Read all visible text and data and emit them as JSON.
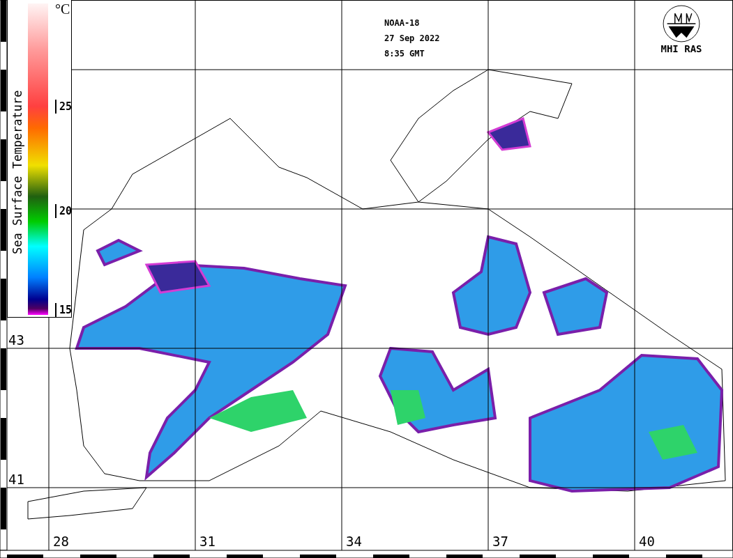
{
  "header": {
    "satellite": "NOAA-18",
    "date": "27 Sep 2022",
    "time": "8:35 GMT"
  },
  "logo": {
    "text": "MHI RAS"
  },
  "colorbar": {
    "title": "Sea Surface Temperature",
    "unit": "°C",
    "ticks": [
      "25",
      "20",
      "15"
    ]
  },
  "latitude_labels": [
    "43",
    "41"
  ],
  "longitude_labels": [
    "28",
    "31",
    "34",
    "37",
    "40"
  ]
}
